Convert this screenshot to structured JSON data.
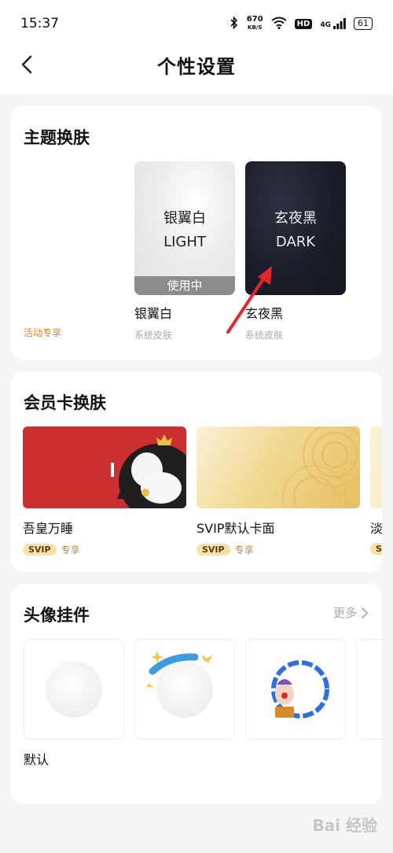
{
  "status_bar": {
    "time": "15:37",
    "speed_value": "670",
    "speed_unit": "KB/S",
    "hd": "HD",
    "network": "4G",
    "battery": "61"
  },
  "nav": {
    "title": "个性设置"
  },
  "theme_section": {
    "title": "主题换肤",
    "promo_tag": "活动专享",
    "items": [
      {
        "thumb_line1": "银翼白",
        "thumb_line2": "LIGHT",
        "in_use": "使用中",
        "name": "银翼白",
        "sub": "系统皮肤"
      },
      {
        "thumb_line1": "玄夜黑",
        "thumb_line2": "DARK",
        "name": "玄夜黑",
        "sub": "系统皮肤"
      }
    ]
  },
  "member_section": {
    "title": "会员卡换肤",
    "items": [
      {
        "name": "吾皇万睡",
        "badge": "SVIP",
        "badge_suffix": "专享"
      },
      {
        "name": "SVIP默认卡面",
        "badge": "SVIP",
        "badge_suffix": "专享"
      },
      {
        "name": "淡",
        "badge": "S",
        "badge_suffix": ""
      }
    ]
  },
  "avatar_section": {
    "title": "头像挂件",
    "more": "更多",
    "items": [
      {
        "label": "默认"
      }
    ]
  },
  "watermark": "Bai 经验",
  "colors": {
    "accent_orange": "#d9862c",
    "member_red": "#cc2f30",
    "arrow_red": "#e3262a"
  }
}
